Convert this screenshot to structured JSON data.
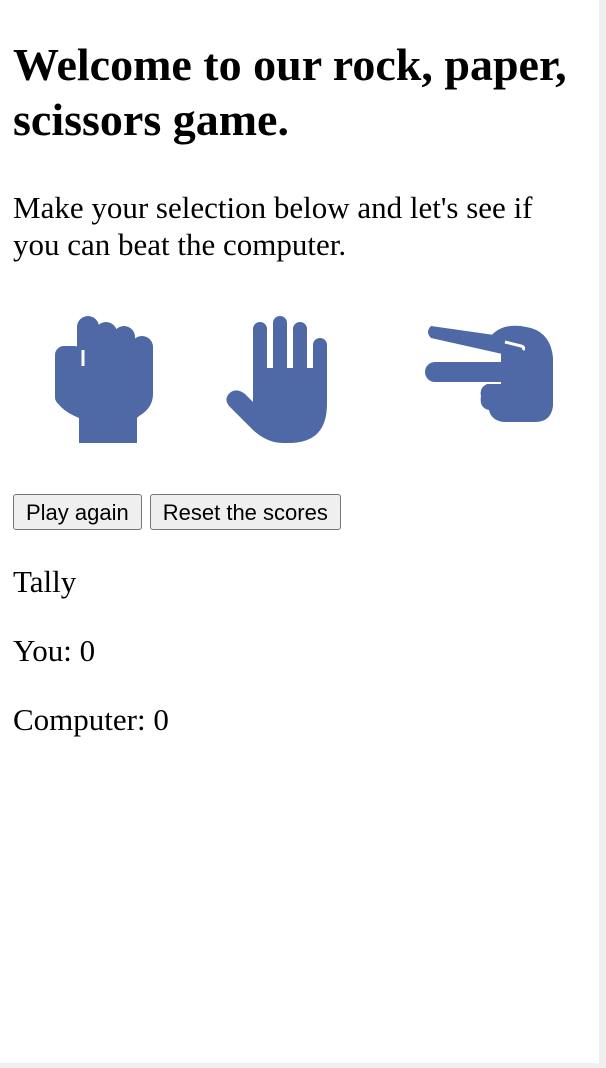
{
  "heading": "Welcome to our rock, paper, scissors game.",
  "intro": "Make your selection below and let's see if you can beat the computer.",
  "choices": [
    {
      "name": "rock",
      "icon": "fist-rock-icon"
    },
    {
      "name": "paper",
      "icon": "open-hand-paper-icon"
    },
    {
      "name": "scissors",
      "icon": "two-finger-scissors-icon"
    }
  ],
  "icon_color": "#4f69a6",
  "buttons": {
    "play_again": "Play again",
    "reset_scores": "Reset the scores"
  },
  "tally": {
    "title": "Tally",
    "you": "You: 0",
    "computer": "Computer: 0"
  }
}
